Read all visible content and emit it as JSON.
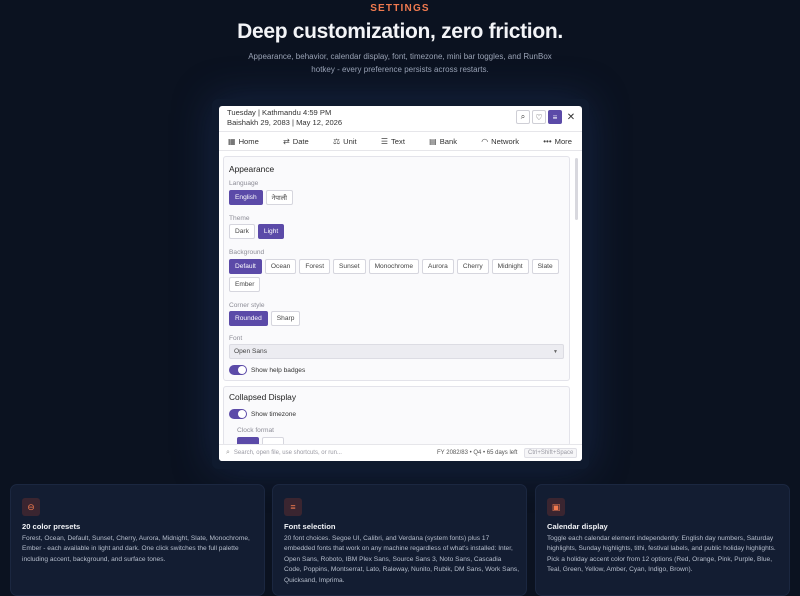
{
  "hero": {
    "eyebrow": "SETTINGS",
    "headline": "Deep customization, zero friction.",
    "subhead": "Appearance, behavior, calendar display, font, timezone, mini bar toggles, and RunBox hotkey - every preference persists across restarts."
  },
  "window": {
    "line1": "Tuesday | Kathmandu 4:59 PM",
    "line2": "Baishakh 29, 2083 | May 12, 2026",
    "buttons": {
      "search": "⌕",
      "heart": "♡",
      "settings": "≡",
      "close": "✕"
    },
    "nav": [
      {
        "icon": "▦",
        "label": "Home"
      },
      {
        "icon": "⇄",
        "label": "Date"
      },
      {
        "icon": "⚖",
        "label": "Unit"
      },
      {
        "icon": "☰",
        "label": "Text"
      },
      {
        "icon": "▤",
        "label": "Bank"
      },
      {
        "icon": "◠",
        "label": "Network"
      },
      {
        "icon": "•••",
        "label": "More"
      }
    ],
    "appearance": {
      "title": "Appearance",
      "language_label": "Language",
      "language_options": [
        "English",
        "नेपाली"
      ],
      "theme_label": "Theme",
      "theme_options": [
        "Dark",
        "Light"
      ],
      "background_label": "Background",
      "background_options": [
        "Default",
        "Ocean",
        "Forest",
        "Sunset",
        "Monochrome",
        "Aurora",
        "Cherry",
        "Midnight",
        "Slate",
        "Ember"
      ],
      "corner_label": "Corner style",
      "corner_options": [
        "Rounded",
        "Sharp"
      ],
      "font_label": "Font",
      "font_value": "Open Sans",
      "help_badges": "Show help badges"
    },
    "collapsed": {
      "title": "Collapsed Display",
      "show_timezone": "Show timezone",
      "clock_format": "Clock format"
    },
    "footer": {
      "placeholder": "Search, open file, use shortcuts, or run...",
      "fy": "FY 2082/83 • Q4 • 65 days left",
      "hotkey": "Ctrl+Shift+Space"
    }
  },
  "cards": [
    {
      "icon": "⊖",
      "title": "20 color presets",
      "desc": "Forest, Ocean, Default, Sunset, Cherry, Aurora, Midnight, Slate, Monochrome, Ember - each available in light and dark. One click switches the full palette including accent, background, and surface tones."
    },
    {
      "icon": "≡",
      "title": "Font selection",
      "desc": "20 font choices. Segoe UI, Calibri, and Verdana (system fonts) plus 17 embedded fonts that work on any machine regardless of what's installed: Inter, Open Sans, Roboto, IBM Plex Sans, Source Sans 3, Noto Sans, Cascadia Code, Poppins, Montserrat, Lato, Raleway, Nunito, Rubik, DM Sans, Work Sans, Quicksand, Imprima."
    },
    {
      "icon": "▣",
      "title": "Calendar display",
      "desc": "Toggle each calendar element independently: English day numbers, Saturday highlights, Sunday highlights, tithi, festival labels, and public holiday highlights. Pick a holiday accent color from 12 options (Red, Orange, Pink, Purple, Blue, Teal, Green, Yellow, Amber, Cyan, Indigo, Brown)."
    }
  ]
}
